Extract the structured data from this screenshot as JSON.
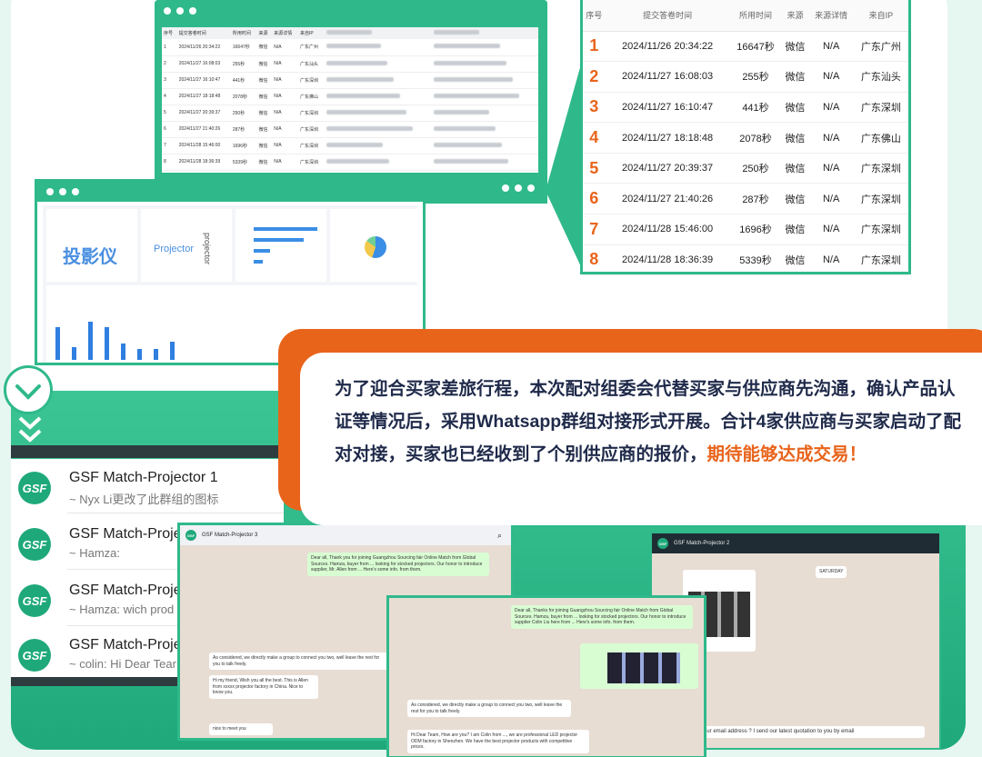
{
  "top_table": {
    "headers": [
      "序号",
      "提交答卷时间",
      "所用时间",
      "来源",
      "来源详情",
      "来自IP"
    ],
    "rows": [
      {
        "n": "1",
        "time": "2024/11/26 20:34:22",
        "dur": "16647秒",
        "src": "微信",
        "detail": "N/A",
        "ip": "广东广州"
      },
      {
        "n": "2",
        "time": "2024/11/27 16:08:03",
        "dur": "255秒",
        "src": "微信",
        "detail": "N/A",
        "ip": "广东汕头"
      },
      {
        "n": "3",
        "time": "2024/11/27 16:10:47",
        "dur": "441秒",
        "src": "微信",
        "detail": "N/A",
        "ip": "广东深圳"
      },
      {
        "n": "4",
        "time": "2024/11/27 18:18:48",
        "dur": "2078秒",
        "src": "微信",
        "detail": "N/A",
        "ip": "广东佛山"
      },
      {
        "n": "5",
        "time": "2024/11/27 20:39:37",
        "dur": "250秒",
        "src": "微信",
        "detail": "N/A",
        "ip": "广东深圳"
      },
      {
        "n": "6",
        "time": "2024/11/27 21:40:26",
        "dur": "287秒",
        "src": "微信",
        "detail": "N/A",
        "ip": "广东深圳"
      },
      {
        "n": "7",
        "time": "2024/11/28 15:46:00",
        "dur": "1696秒",
        "src": "微信",
        "detail": "N/A",
        "ip": "广东深圳"
      },
      {
        "n": "8",
        "time": "2024/11/28 18:36:39",
        "dur": "5339秒",
        "src": "微信",
        "detail": "N/A",
        "ip": "广东深圳"
      }
    ]
  },
  "dashboard": {
    "wordcloud_main": "投影仪",
    "wordcloud_secondary": "Projector",
    "wordcloud_vertical": "projector"
  },
  "callout": {
    "text_main": "为了迎合买家差旅行程，本次配对组委会代替买家与供应商先沟通，确认产品认证等情况后，采用Whatsapp群组对接形式开展。合计4家供应商与买家启动了配对对接，买家也已经收到了个别供应商的报价，",
    "text_highlight": "期待能够达成交易！"
  },
  "chats": [
    {
      "avatar": "GSF",
      "title": "GSF Match-Projector 1",
      "sub": "~ Nyx Li更改了此群组的图标"
    },
    {
      "avatar": "GSF",
      "title": "GSF Match-Proje",
      "sub": "~ Hamza:"
    },
    {
      "avatar": "GSF",
      "title": "GSF Match-Proje",
      "sub": "~ Hamza: wich prod"
    },
    {
      "avatar": "GSF",
      "title": "GSF Match-Proje",
      "sub": "~ colin: Hi Dear Tear"
    }
  ],
  "chat_windows": {
    "left_title": "GSF Match-Projector 3",
    "right_title": "GSF Match-Projector 2",
    "right_date": "SATURDAY",
    "left_msg1": "Dear all, Thank you for joining Guangzhou Sourcing fair Online Match from Global Sources. Hamza, buyer from ... looking for stocked projectors. Our honor to introduce supplier, Mr. Allen from ... Here's some info. from them.",
    "left_msg2": "As considered, we directly make a group to connect you two, well leave the rest for you to talk freely.",
    "left_msg3": "Hi my friend, Wish you all the best. This is Allen from xxxxx projector factory in China. Nice to know you.",
    "left_msg4": "nice to meet you",
    "mid_msg1": "Dear all, Thanks for joining Guangzhou Sourcing fair Online Match from Global Sources. Hamza, buyer from ... looking for stocked projectors. Our honor to introduce supplier Colin Liu here from ... Here's some info. from them.",
    "mid_msg2": "As considered, we directly make a group to connect you two, well leave the rest for you to talk freely.",
    "mid_msg3": "Hi Dear Team, How are you? I am Colin from ..., we are professional LED projector ODM factory in Shenzhen. We have the best projector products with competitive prices.",
    "right_msg": "your email address ? I send our latest quotation to you by email"
  }
}
